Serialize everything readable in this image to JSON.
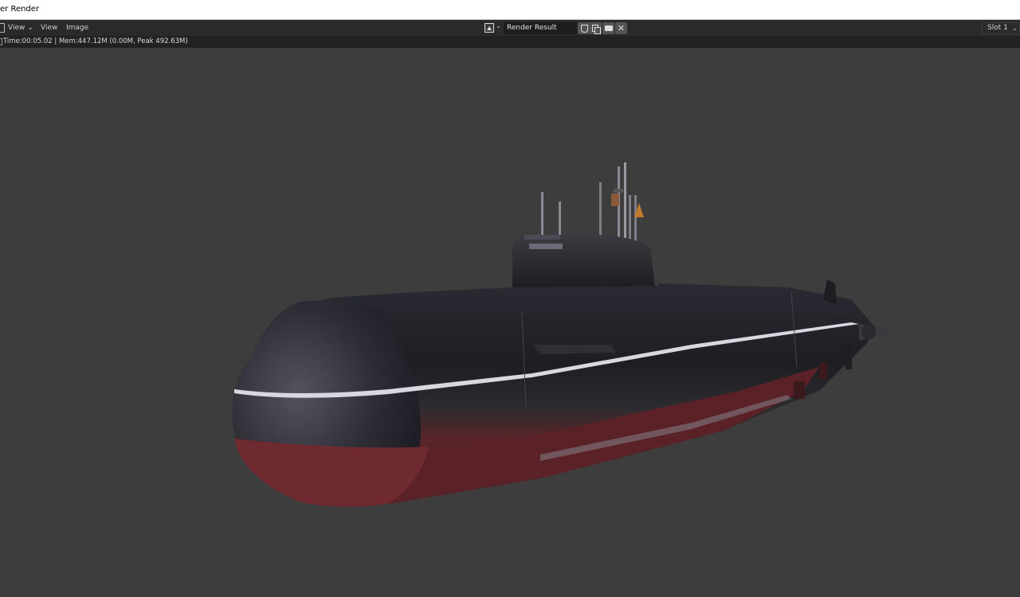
{
  "window": {
    "title": "er Render"
  },
  "header": {
    "menu_view": "View ⌄",
    "menu_view2": "View",
    "menu_image": "Image",
    "image_name": "Render Result",
    "close_glyph": "✕",
    "slot": "Slot 1",
    "chevron": "⌄",
    "icons": {
      "editor_type": "image-editor-icon",
      "image_type": "image-icon",
      "fake_user": "shield-icon",
      "new_image": "duplicate-icon",
      "open_image": "folder-icon",
      "unlink": "close-icon"
    }
  },
  "status": {
    "text": "Time:00:05.02 | Mem:447.12M (0.00M, Peak 492.63M)"
  },
  "colors": {
    "background": "#3c3c3c",
    "render_bg": "#3d3d3d",
    "hull_top": "#1b1b1f",
    "hull_bottom": "#6e2a2e"
  }
}
